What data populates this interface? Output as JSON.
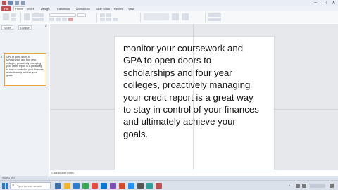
{
  "window": {
    "title": "",
    "controls": [
      "–",
      "▢",
      "✕"
    ]
  },
  "ribbon": {
    "tabs": [
      {
        "label": "File"
      },
      {
        "label": "Home"
      },
      {
        "label": "Insert"
      },
      {
        "label": "Design"
      },
      {
        "label": "Transitions"
      },
      {
        "label": "Animations"
      },
      {
        "label": "Slide Show"
      },
      {
        "label": "Review"
      },
      {
        "label": "View"
      }
    ]
  },
  "left_pane": {
    "tabs": [
      "Slides",
      "Outline"
    ],
    "close_glyph": "×",
    "slide_number": "1",
    "thumbnail_text": "GPA to open doors to scholarships and four year colleges, proactively managing your credit report is a great way to stay in control of your finances and ultimately achieve your goals."
  },
  "slide": {
    "lines": [
      "monitor your coursework and",
      "GPA to open doors to",
      "scholarships and four year",
      "colleges, proactively managing",
      "your credit report is a great way",
      "to stay in control of your finances",
      "and ultimately achieve your",
      "goals."
    ]
  },
  "notes": {
    "placeholder": "Click to add notes"
  },
  "statusbar": {
    "text": "Slide 1 of 1"
  },
  "taskbar": {
    "search_glyph": "⌕",
    "search_placeholder": "Type here to search",
    "icon_colors": [
      "#3a6ea5",
      "#f0b429",
      "#2b7cd3",
      "#34a853",
      "#e84c3d",
      "#0078d4",
      "#7b4fb5",
      "#d24726",
      "#1e90ff",
      "#555555",
      "#2aa198",
      "#c0504d"
    ],
    "tray_glyph": "^"
  },
  "colors": {
    "accent": "#c0504d",
    "selection": "#e8a33d"
  }
}
